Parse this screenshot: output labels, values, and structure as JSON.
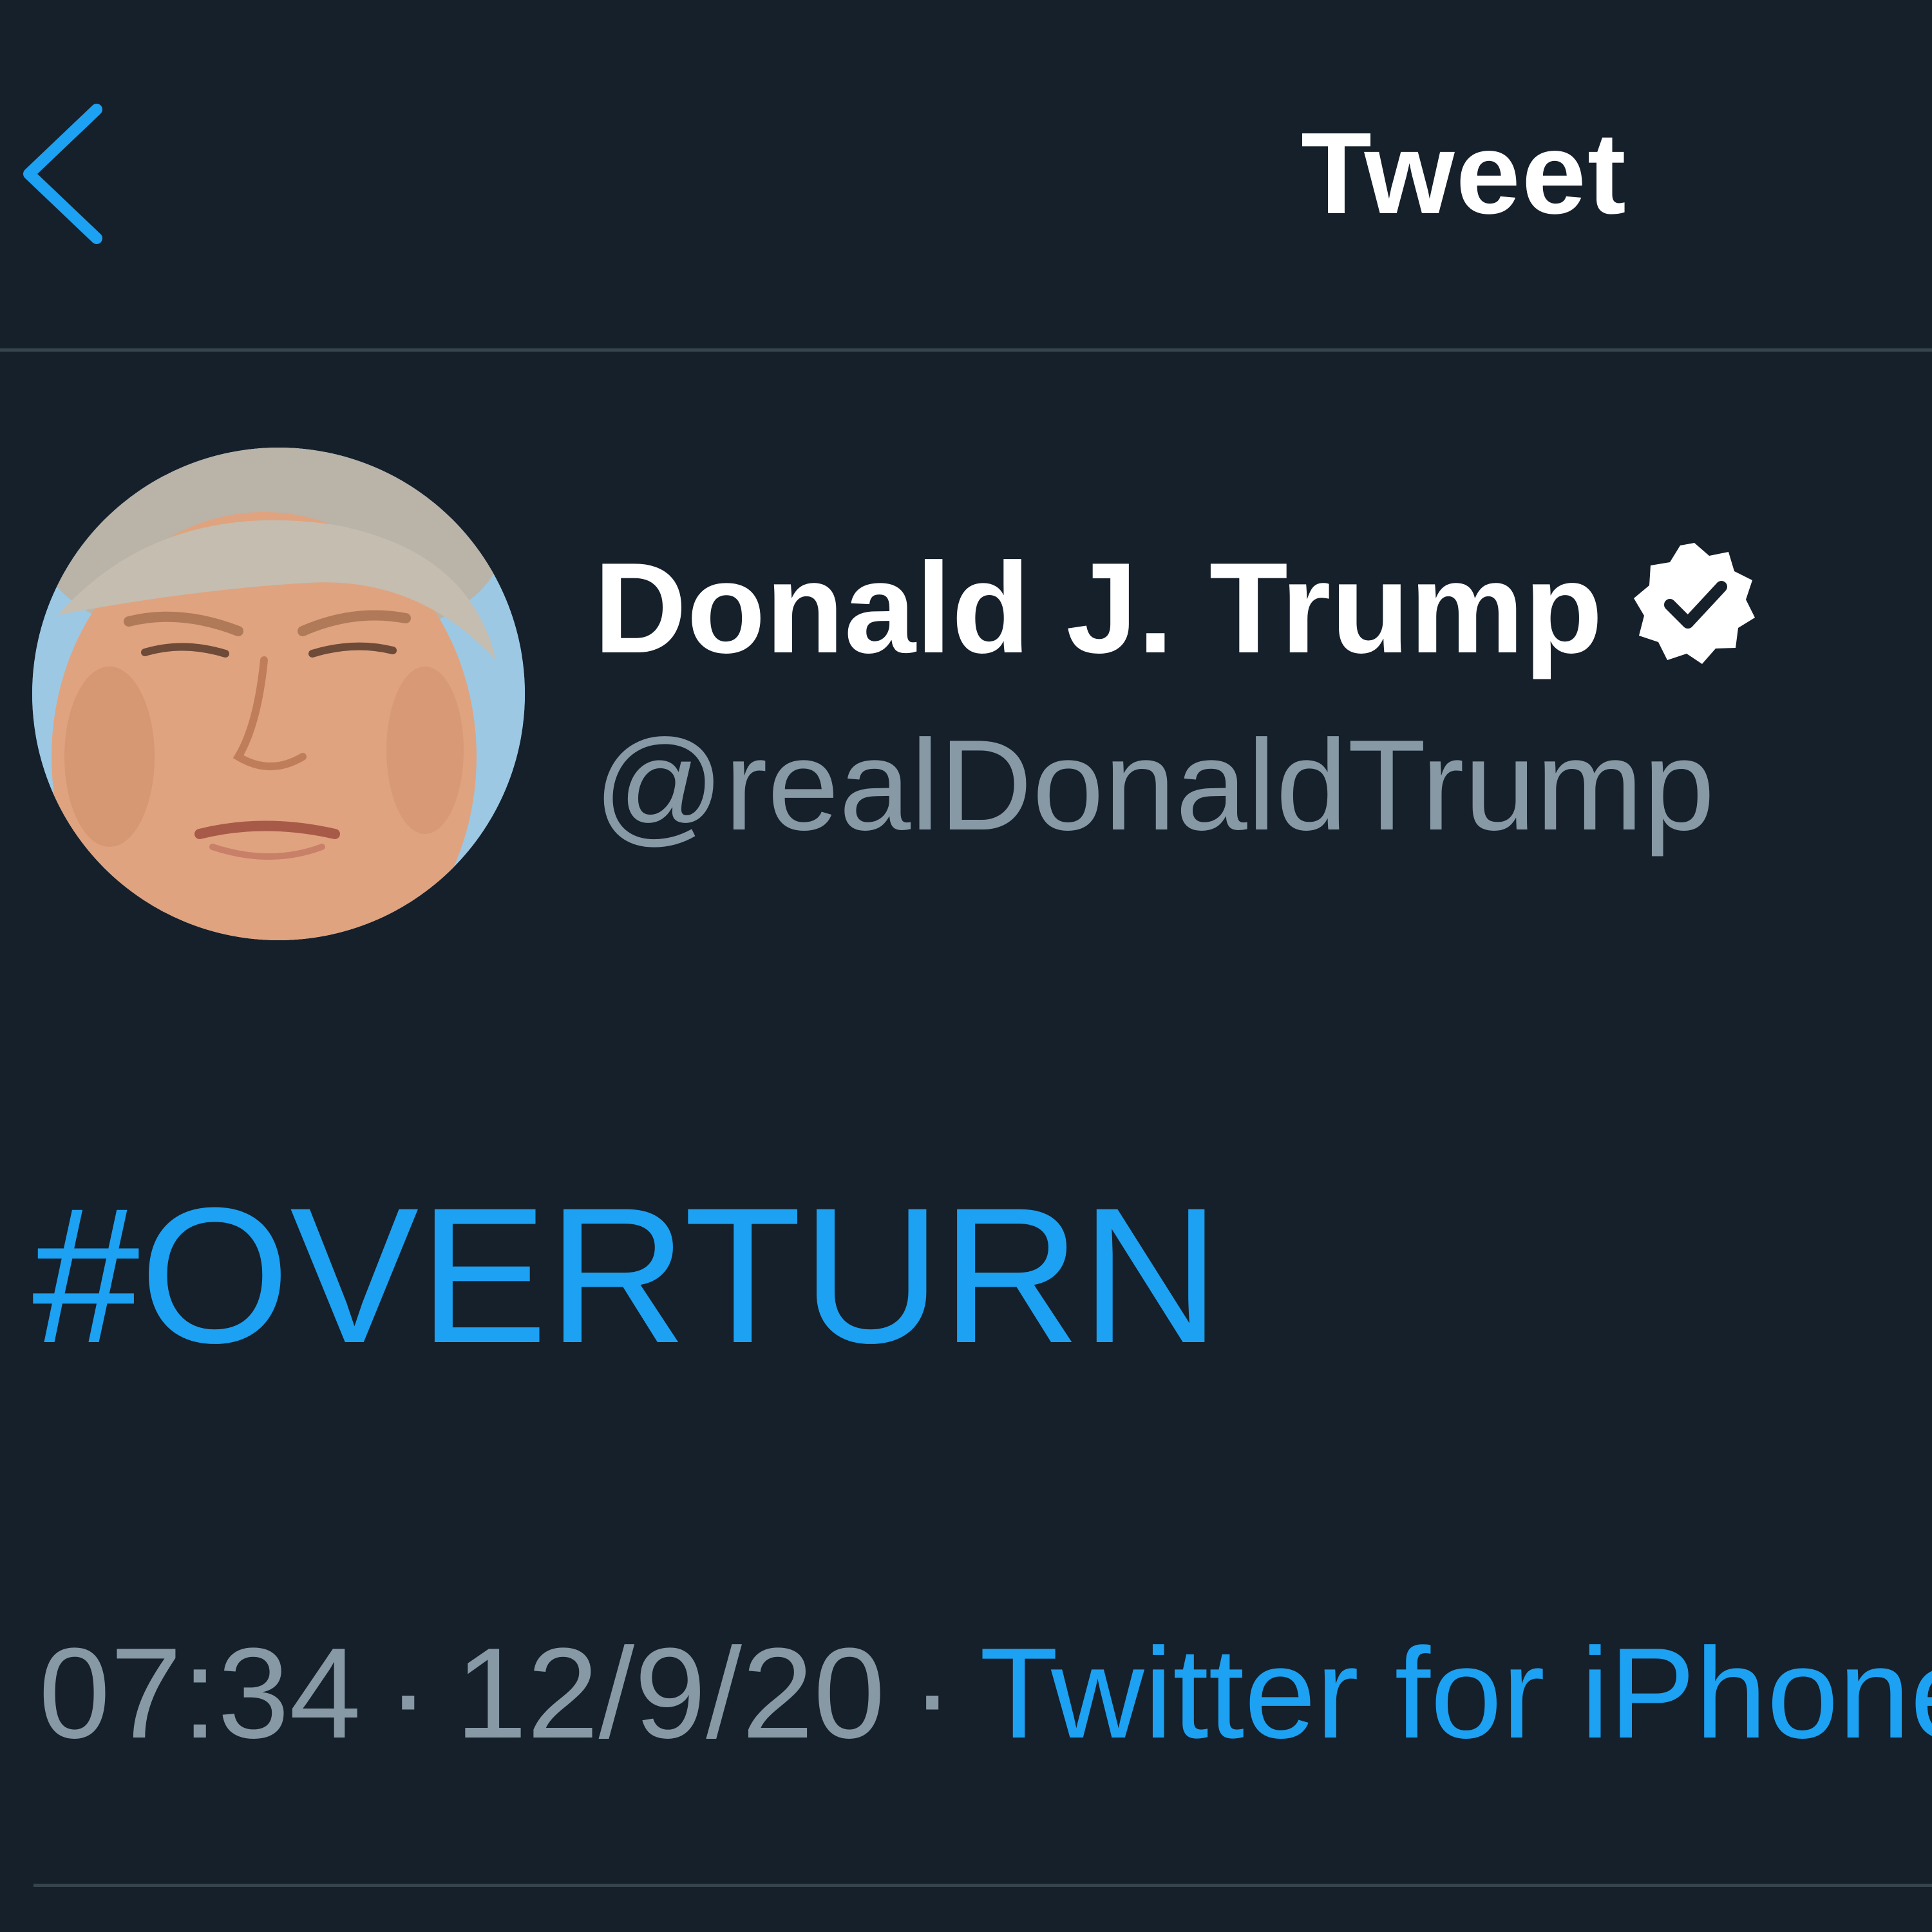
{
  "header": {
    "title": "Tweet",
    "back_icon": "chevron-left-icon"
  },
  "author": {
    "display_name": "Donald J. Trump",
    "handle": "@realDonaldTrump",
    "verified_icon": "verified-badge-icon"
  },
  "tweet": {
    "text": "#OVERTURN"
  },
  "meta": {
    "time": "07:34",
    "date": "12/9/20",
    "separator": "·",
    "source": "Twitter for iPhone"
  },
  "colors": {
    "background": "#15202b",
    "accent": "#1da1f2",
    "muted": "#8899a6",
    "divider": "#38444d",
    "primary_text": "#ffffff"
  }
}
